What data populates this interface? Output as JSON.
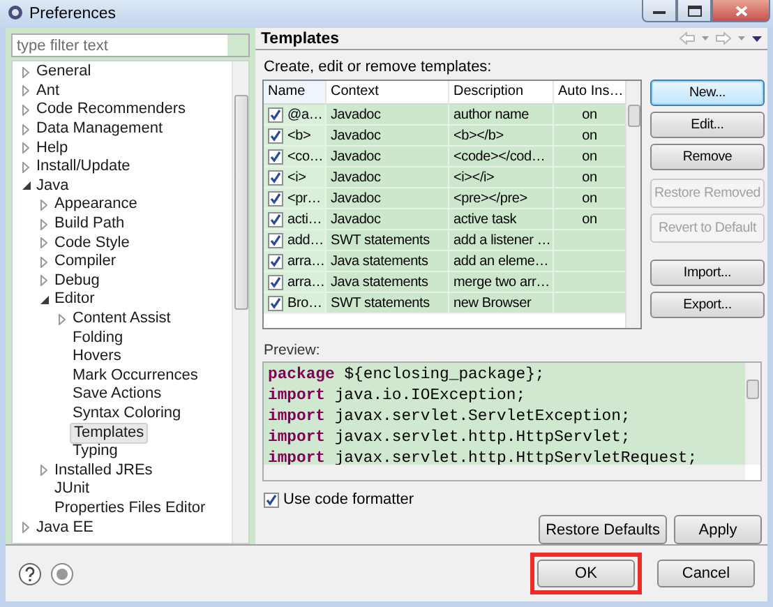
{
  "window": {
    "title": "Preferences"
  },
  "filter": {
    "placeholder": "type filter text"
  },
  "tree": [
    {
      "label": "General",
      "expanded": false,
      "selected": false
    },
    {
      "label": "Ant",
      "expanded": false,
      "selected": false
    },
    {
      "label": "Code Recommenders",
      "expanded": false,
      "selected": false
    },
    {
      "label": "Data Management",
      "expanded": false,
      "selected": false
    },
    {
      "label": "Help",
      "expanded": false,
      "selected": false
    },
    {
      "label": "Install/Update",
      "expanded": false,
      "selected": false
    },
    {
      "label": "Java",
      "expanded": true,
      "selected": false,
      "children": [
        {
          "label": "Appearance",
          "expanded": false,
          "selected": false
        },
        {
          "label": "Build Path",
          "expanded": false,
          "selected": false
        },
        {
          "label": "Code Style",
          "expanded": false,
          "selected": false
        },
        {
          "label": "Compiler",
          "expanded": false,
          "selected": false
        },
        {
          "label": "Debug",
          "expanded": false,
          "selected": false
        },
        {
          "label": "Editor",
          "expanded": true,
          "selected": false,
          "children": [
            {
              "label": "Content Assist",
              "expanded": false,
              "selected": false
            },
            {
              "label": "Folding",
              "selected": false
            },
            {
              "label": "Hovers",
              "selected": false
            },
            {
              "label": "Mark Occurrences",
              "selected": false
            },
            {
              "label": "Save Actions",
              "selected": false
            },
            {
              "label": "Syntax Coloring",
              "selected": false
            },
            {
              "label": "Templates",
              "selected": true
            },
            {
              "label": "Typing",
              "selected": false
            }
          ]
        },
        {
          "label": "Installed JREs",
          "expanded": false,
          "selected": false
        },
        {
          "label": "JUnit",
          "selected": false
        },
        {
          "label": "Properties Files Editor",
          "selected": false
        }
      ]
    },
    {
      "label": "Java EE",
      "expanded": false,
      "selected": false
    }
  ],
  "page": {
    "title": "Templates",
    "description": "Create, edit or remove templates:"
  },
  "table": {
    "columns": [
      "Name",
      "Context",
      "Description",
      "Auto Ins…"
    ],
    "rows": [
      {
        "checked": true,
        "name": "@a…",
        "context": "Javadoc",
        "description": "author name",
        "auto_insert": "on"
      },
      {
        "checked": true,
        "name": "<b>",
        "context": "Javadoc",
        "description": "<b></b>",
        "auto_insert": "on"
      },
      {
        "checked": true,
        "name": "<co…",
        "context": "Javadoc",
        "description": "<code></cod…",
        "auto_insert": "on"
      },
      {
        "checked": true,
        "name": "<i>",
        "context": "Javadoc",
        "description": "<i></i>",
        "auto_insert": "on"
      },
      {
        "checked": true,
        "name": "<pr…",
        "context": "Javadoc",
        "description": "<pre></pre>",
        "auto_insert": "on"
      },
      {
        "checked": true,
        "name": "acti…",
        "context": "Javadoc",
        "description": "active task",
        "auto_insert": "on"
      },
      {
        "checked": true,
        "name": "add…",
        "context": "SWT statements",
        "description": "add a listener …"
      },
      {
        "checked": true,
        "name": "arra…",
        "context": "Java statements",
        "description": "add an eleme…"
      },
      {
        "checked": true,
        "name": "arra…",
        "context": "Java statements",
        "description": "merge two arr…"
      },
      {
        "checked": true,
        "name": "Bro…",
        "context": "SWT statements",
        "description": "new Browser"
      }
    ]
  },
  "side_buttons": [
    {
      "label": "New...",
      "disabled": false,
      "default": true
    },
    {
      "label": "Edit...",
      "disabled": false,
      "default": false
    },
    {
      "label": "Remove",
      "disabled": false,
      "default": false
    },
    {
      "label": "Restore Removed",
      "disabled": true,
      "default": false
    },
    {
      "label": "Revert to Default",
      "disabled": true,
      "default": false
    },
    {
      "label": "Import...",
      "disabled": false,
      "default": false
    },
    {
      "label": "Export...",
      "disabled": false,
      "default": false
    }
  ],
  "preview": {
    "label": "Preview:",
    "lines": [
      {
        "keyword": "package",
        "text": " ${enclosing_package};"
      },
      {
        "keyword": "import",
        "text": " java.io.IOException;"
      },
      {
        "keyword": "import",
        "text": " javax.servlet.ServletException;"
      },
      {
        "keyword": "import",
        "text": " javax.servlet.http.HttpServlet;"
      },
      {
        "keyword": "import",
        "text": " javax.servlet.http.HttpServletRequest;"
      }
    ]
  },
  "formatter": {
    "label": "Use code formatter",
    "checked": true
  },
  "page_buttons": [
    "Restore Defaults",
    "Apply"
  ],
  "dialog_buttons": [
    {
      "label": "OK",
      "highlighted": true
    },
    {
      "label": "Cancel",
      "highlighted": false
    }
  ]
}
